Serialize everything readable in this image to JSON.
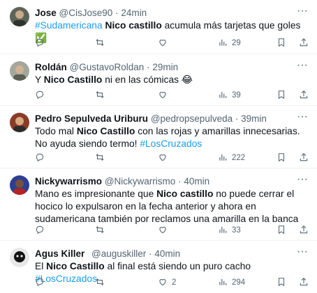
{
  "tweets": [
    {
      "name": "Jose",
      "handle": "@CisJose90",
      "time": "24min",
      "text": [
        {
          "t": "#Sudamericana",
          "s": "tag"
        },
        {
          "t": " "
        },
        {
          "t": "Nico castillo",
          "s": "bold"
        },
        {
          "t": " acumula más tarjetas que goles ✅"
        }
      ],
      "replies": "",
      "retweets": "",
      "likes": "",
      "views": "29",
      "avatar_color": "#3b3f3a"
    },
    {
      "name": "Roldán",
      "handle": "@GustavoRoldan",
      "time": "29min",
      "text": [
        {
          "t": "Y "
        },
        {
          "t": "Nico Castillo",
          "s": "bold"
        },
        {
          "t": " ni en las cómicas 😂"
        }
      ],
      "replies": "",
      "retweets": "",
      "likes": "",
      "views": "39",
      "avatar_color": "#8a8f86"
    },
    {
      "name": "Pedro Sepulveda Uriburu",
      "handle": "@pedropsepulveda",
      "time": "39min",
      "text": [
        {
          "t": "Todo mal "
        },
        {
          "t": "Nico Castillo",
          "s": "bold"
        },
        {
          "t": " con las rojas y amarillas innecesarias. No ayuda siendo termo! "
        },
        {
          "t": "#LosCruzados",
          "s": "tag"
        }
      ],
      "replies": "",
      "retweets": "",
      "likes": "",
      "views": "222",
      "avatar_color": "#7a3b2a"
    },
    {
      "name": "Nickywarrismo",
      "handle": "@Nickywarrismo",
      "time": "40min",
      "text": [
        {
          "t": "Mano es impresionante que "
        },
        {
          "t": "Nico castillo",
          "s": "bold"
        },
        {
          "t": " no puede cerrar el hocico lo expulsaron en la fecha anterior y ahora en sudamericana también por reclamos una amarilla en la banca"
        }
      ],
      "replies": "",
      "retweets": "",
      "likes": "",
      "views": "33",
      "avatar_color": "#2a3a8a"
    },
    {
      "name": "Agus Killer",
      "handle": "@auguskiller",
      "time": "40min",
      "text": [
        {
          "t": "El "
        },
        {
          "t": "Nico Castillo",
          "s": "bold"
        },
        {
          "t": " al final está siendo un puro cacho "
        },
        {
          "t": "#LosCruzados",
          "s": "tag"
        }
      ],
      "replies": "",
      "retweets": "",
      "likes": "2",
      "views": "294",
      "avatar_color": "#1a1a1a"
    }
  ],
  "dot": "·",
  "more_glyph": "···",
  "colors": {
    "accent": "#1d9bf0",
    "muted": "#536471",
    "text": "#0f1419"
  },
  "icons": [
    "reply-icon",
    "retweet-icon",
    "like-icon",
    "views-icon",
    "bookmark-icon",
    "share-icon",
    "more-icon"
  ]
}
